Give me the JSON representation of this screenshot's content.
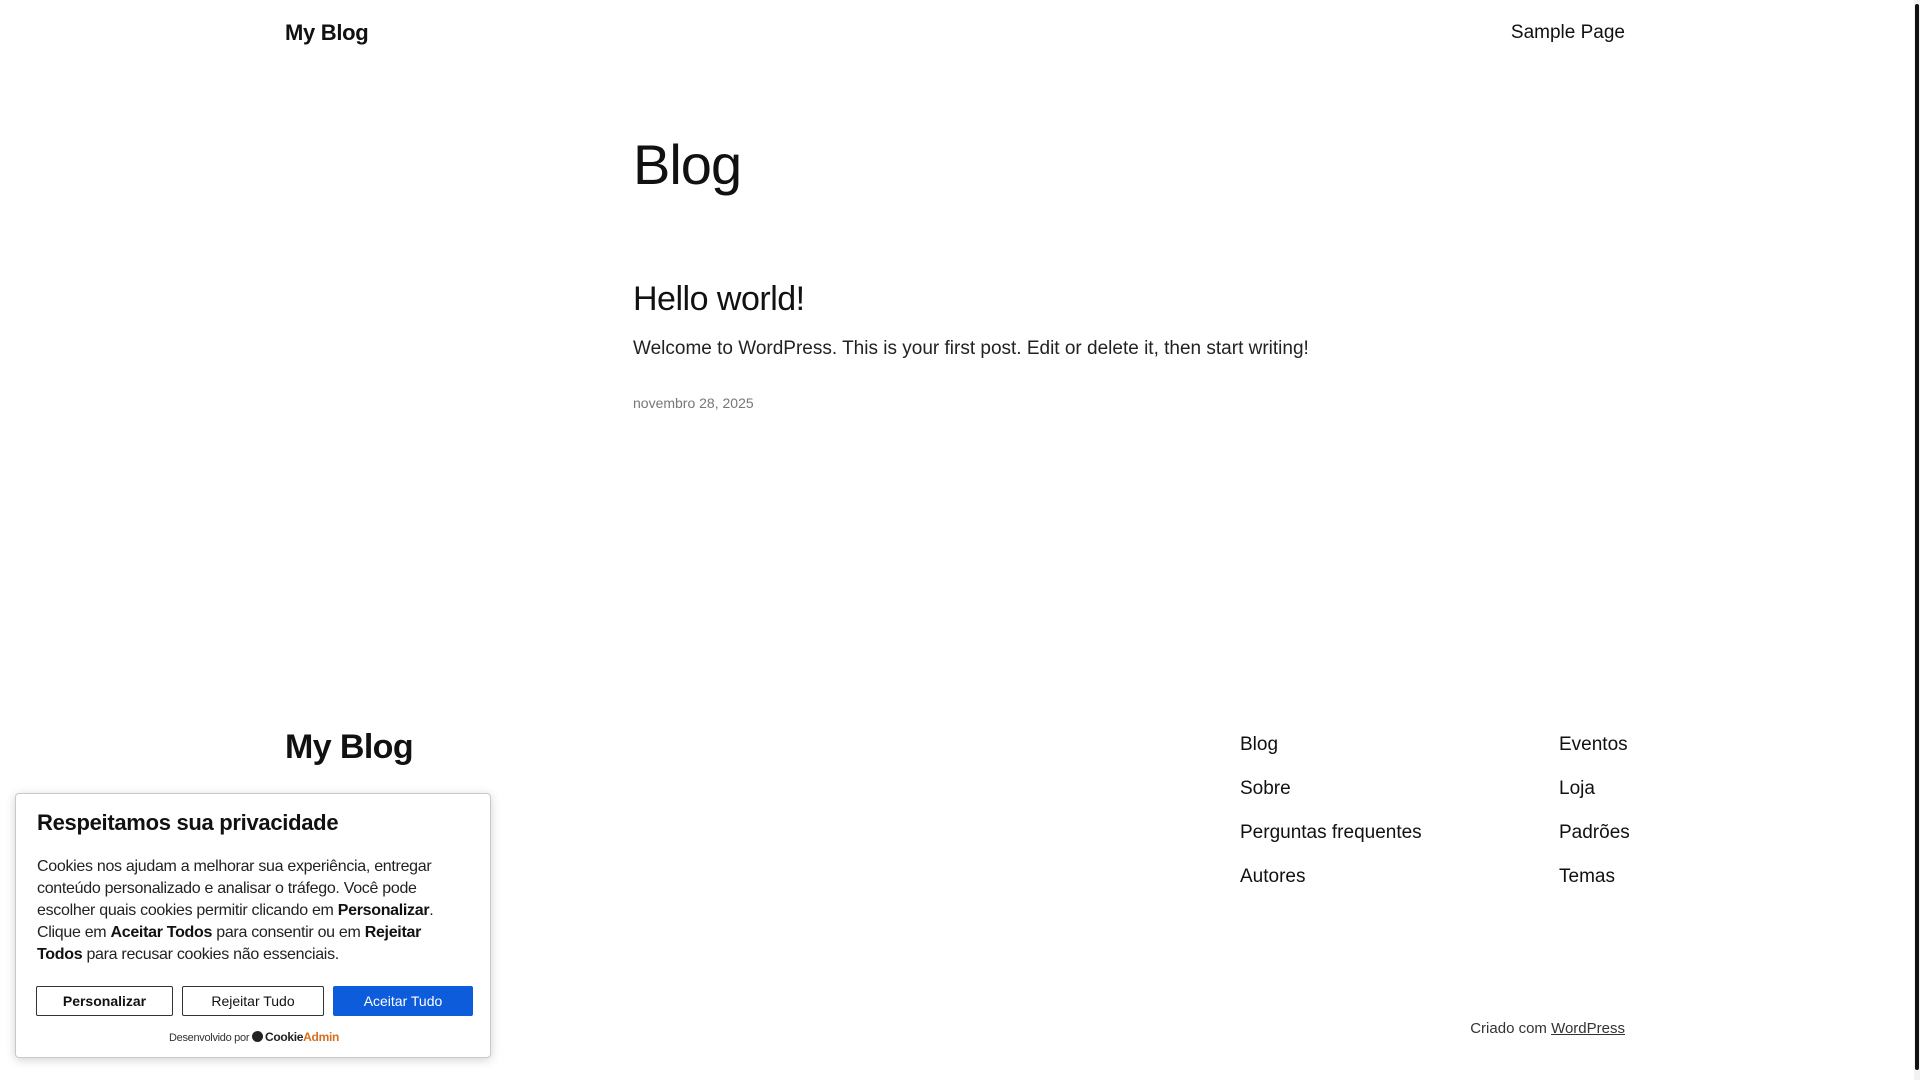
{
  "header": {
    "site_title": "My Blog",
    "nav": [
      {
        "label": "Sample Page"
      }
    ]
  },
  "main": {
    "page_title": "Blog",
    "posts": [
      {
        "title": "Hello world!",
        "excerpt": "Welcome to WordPress. This is your first post. Edit or delete it, then start writing!",
        "date": "novembro 28, 2025"
      }
    ]
  },
  "footer": {
    "site_title": "My Blog",
    "columns": [
      [
        "Blog",
        "Sobre",
        "Perguntas frequentes",
        "Autores"
      ],
      [
        "Eventos",
        "Loja",
        "Padrões",
        "Temas"
      ]
    ],
    "credit_prefix": "Criado com ",
    "credit_link": "WordPress"
  },
  "cookie_banner": {
    "heading": "Respeitamos sua privacidade",
    "text": {
      "part1": "Cookies nos ajudam a melhorar sua experiência, entregar conteúdo personalizado e analisar o tráfego. Você pode escolher quais cookies permitir clicando em ",
      "bold1": "Personalizar",
      "part2": ". Clique em ",
      "bold2": "Aceitar Todos",
      "part3": " para consentir ou em ",
      "bold3": "Rejeitar Todos",
      "part4": " para recusar cookies não essenciais."
    },
    "buttons": {
      "customize": "Personalizar",
      "reject": "Rejeitar Tudo",
      "accept": "Aceitar Tudo"
    },
    "powered_by": "Desenvolvido por",
    "brand_part1": "Cookie",
    "brand_part2": "Admin",
    "accent_color": "#0d5cdb"
  }
}
